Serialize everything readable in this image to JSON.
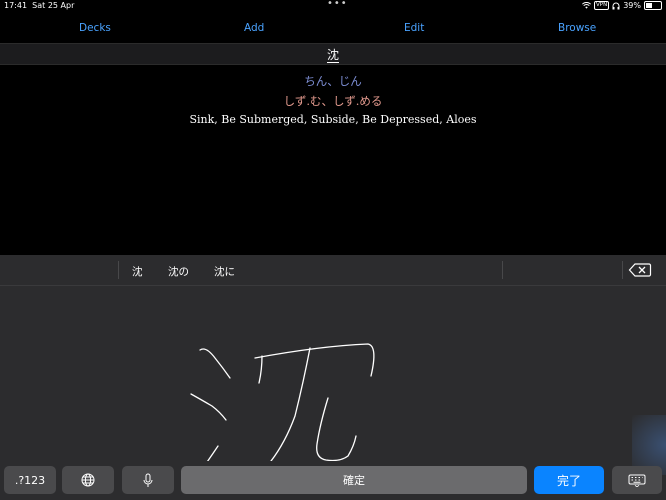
{
  "status": {
    "time": "17:41",
    "date": "Sat 25 Apr",
    "vpn": "VPN",
    "battery": "39%",
    "dots": "•••"
  },
  "nav": {
    "decks": "Decks",
    "add": "Add",
    "edit": "Edit",
    "browse": "Browse"
  },
  "card": {
    "kanji": "沈",
    "on_reading": "ちん、じん",
    "kun_reading": "しず.む、しず.める",
    "meaning": "Sink, Be Submerged, Subside, Be Depressed, Aloes"
  },
  "candidates": [
    "沈",
    "沈の",
    "沈に"
  ],
  "keys": {
    "numbers": ".?123",
    "confirm": "確定",
    "done": "完了"
  },
  "colors": {
    "accent": "#4aa3ff",
    "on_reading": "#7e8fd6",
    "kun_reading": "#e39a8e",
    "done_key": "#0a84ff"
  },
  "icons": [
    "wifi-icon",
    "headphones-icon",
    "battery-icon",
    "delete-icon",
    "globe-icon",
    "microphone-icon",
    "keyboard-dismiss-icon"
  ]
}
